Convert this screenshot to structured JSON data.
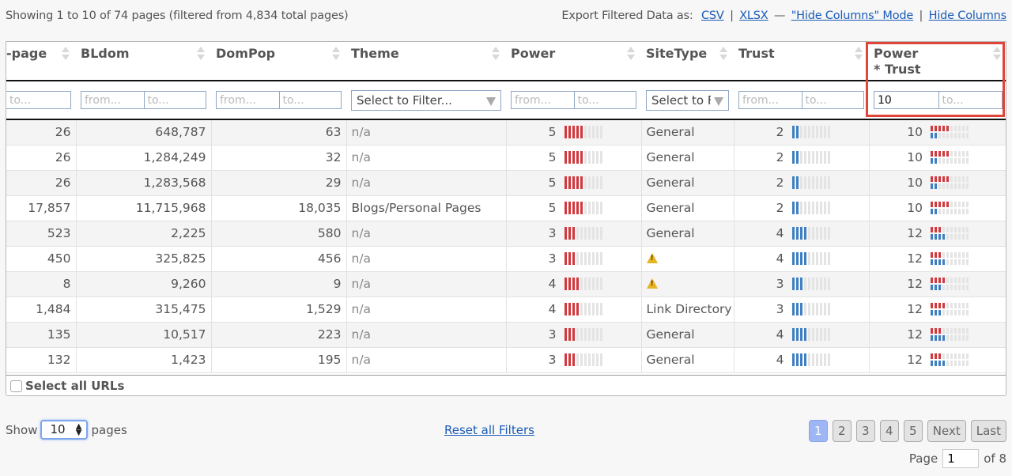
{
  "summary": {
    "info": "Showing 1 to 10 of 74 pages (filtered from 4,834 total pages)",
    "export_label": "Export Filtered Data as:",
    "csv": "CSV",
    "xlsx": "XLSX",
    "dash": "—",
    "hide_mode": "\"Hide Columns\" Mode",
    "hide_columns": "Hide Columns",
    "pipe": "|"
  },
  "columns": [
    {
      "label": "-page"
    },
    {
      "label": "BLdom"
    },
    {
      "label": "DomPop"
    },
    {
      "label": "Theme"
    },
    {
      "label": "Power"
    },
    {
      "label": "SiteType"
    },
    {
      "label": "Trust"
    },
    {
      "label": "Power",
      "label2": "* Trust"
    }
  ],
  "filters": {
    "from_placeholder": "from...",
    "to_placeholder": "to...",
    "select_placeholder": "Select to Filter...",
    "sitetype_select": "Select to F",
    "power_trust_from": "10"
  },
  "rows": [
    {
      "page": "26",
      "bldom": "648,787",
      "dompop": "63",
      "theme": "n/a",
      "power": 5,
      "sitetype": "General",
      "trust": 2,
      "power_trust": 10
    },
    {
      "page": "26",
      "bldom": "1,284,249",
      "dompop": "32",
      "theme": "n/a",
      "power": 5,
      "sitetype": "General",
      "trust": 2,
      "power_trust": 10
    },
    {
      "page": "26",
      "bldom": "1,283,568",
      "dompop": "29",
      "theme": "n/a",
      "power": 5,
      "sitetype": "General",
      "trust": 2,
      "power_trust": 10
    },
    {
      "page": "17,857",
      "bldom": "11,715,968",
      "dompop": "18,035",
      "theme": "Blogs/Personal Pages",
      "power": 5,
      "sitetype": "General",
      "trust": 2,
      "power_trust": 10
    },
    {
      "page": "523",
      "bldom": "2,225",
      "dompop": "580",
      "theme": "n/a",
      "power": 3,
      "sitetype": "General",
      "trust": 4,
      "power_trust": 12
    },
    {
      "page": "450",
      "bldom": "325,825",
      "dompop": "456",
      "theme": "n/a",
      "power": 3,
      "sitetype": "warning-icon",
      "trust": 4,
      "power_trust": 12
    },
    {
      "page": "8",
      "bldom": "9,260",
      "dompop": "9",
      "theme": "n/a",
      "power": 4,
      "sitetype": "warning-icon",
      "trust": 3,
      "power_trust": 12
    },
    {
      "page": "1,484",
      "bldom": "315,475",
      "dompop": "1,529",
      "theme": "n/a",
      "power": 4,
      "sitetype": "Link Directory",
      "trust": 3,
      "power_trust": 12
    },
    {
      "page": "135",
      "bldom": "10,517",
      "dompop": "223",
      "theme": "n/a",
      "power": 3,
      "sitetype": "General",
      "trust": 4,
      "power_trust": 12
    },
    {
      "page": "132",
      "bldom": "1,423",
      "dompop": "195",
      "theme": "n/a",
      "power": 3,
      "sitetype": "General",
      "trust": 4,
      "power_trust": 12
    }
  ],
  "bar_scale_max": 10,
  "colors": {
    "power": "#d0393e",
    "trust": "#3f7fc1",
    "empty": "#e4e4e4",
    "highlight": "#e0453a"
  },
  "footer": {
    "select_all": "Select all URLs"
  },
  "bottom": {
    "show_label": "Show",
    "show_value": "10",
    "pages_label": "pages",
    "reset": "Reset all Filters",
    "pages": [
      "1",
      "2",
      "3",
      "4",
      "5"
    ],
    "active_page": "1",
    "next": "Next",
    "last": "Last",
    "page_label": "Page",
    "page_value": "1",
    "of_label": "of 8"
  }
}
